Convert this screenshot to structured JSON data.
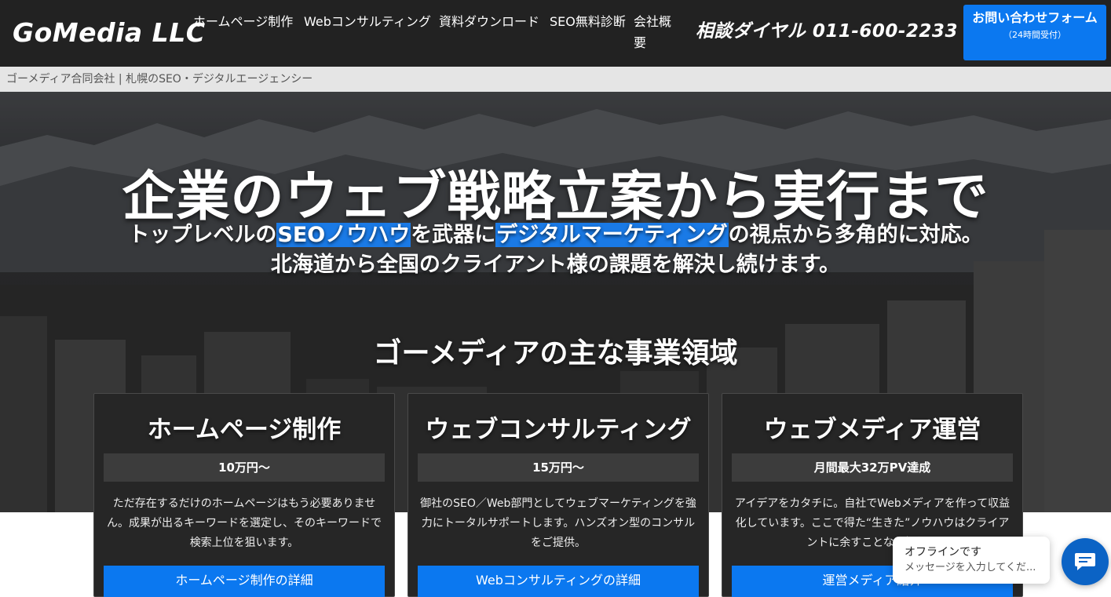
{
  "header": {
    "logo": "GoMedia LLC",
    "nav": [
      {
        "label": "ホームページ制作"
      },
      {
        "label": "Webコンサルティング"
      },
      {
        "label": "資料ダウンロード"
      },
      {
        "label": "SEO無料診断"
      },
      {
        "label": "会社概要"
      }
    ],
    "phone": "相談ダイヤル 011-600-2233",
    "cta_main": "お問い合わせフォーム",
    "cta_sub": "（24時間受付）"
  },
  "subbar": {
    "text": "ゴーメディア合同会社 | 札幌のSEO・デジタルエージェンシー"
  },
  "hero": {
    "title": "企業のウェブ戦略立案から実行まで",
    "sub1_a": "トップレベルの",
    "sub1_hl1": "SEOノウハウ",
    "sub1_b": "を武器に",
    "sub1_hl2": "デジタルマーケティング",
    "sub1_c": "の視点から多角的に対応。",
    "sub2": "北海道から全国のクライアント様の課題を解決し続けます。",
    "section_title": "ゴーメディアの主な事業領域"
  },
  "cards": [
    {
      "title": "ホームページ制作",
      "price": "10万円〜",
      "desc": "ただ存在するだけのホームページはもう必要ありません。成果が出るキーワードを選定し、そのキーワードで検索上位を狙います。",
      "button": "ホームページ制作の詳細"
    },
    {
      "title": "ウェブコンサルティング",
      "price": "15万円〜",
      "desc": "御社のSEO／Web部門としてウェブマーケティングを強力にトータルサポートします。ハンズオン型のコンサルをご提供。",
      "button": "Webコンサルティングの詳細"
    },
    {
      "title": "ウェブメディア運営",
      "price": "月間最大32万PV達成",
      "desc": "アイデアをカタチに。自社でWebメディアを作って収益化しています。ここで得た“生きた”ノウハウはクライアントに余すことなく提供。",
      "button": "運営メディア紹介"
    }
  ],
  "chat": {
    "status": "オフラインです",
    "message": "メッセージを入力してくだ..."
  }
}
